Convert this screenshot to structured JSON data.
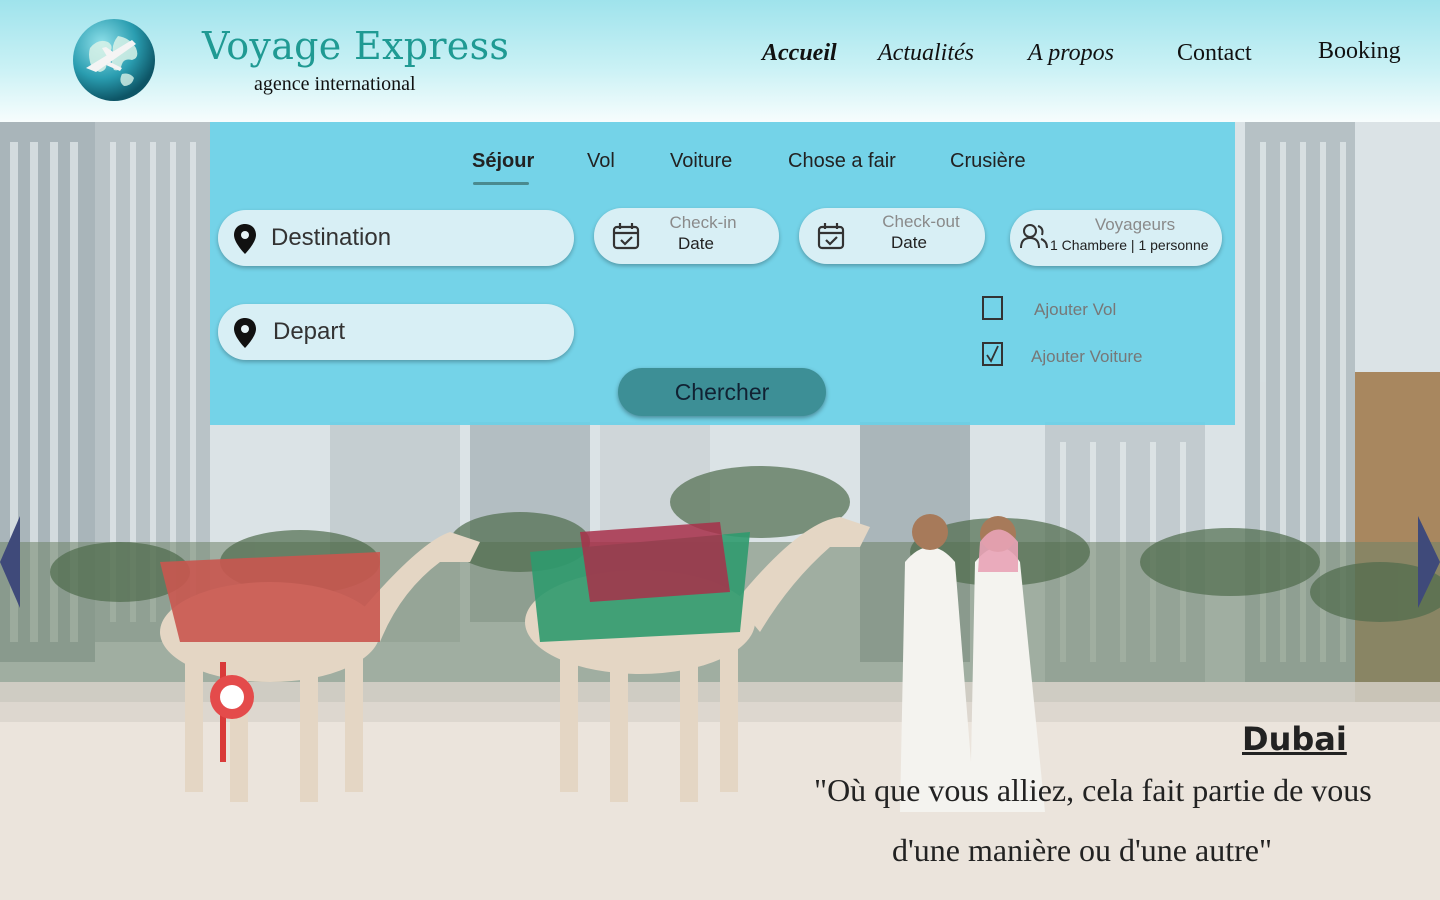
{
  "brand": {
    "title": "Voyage Express",
    "subtitle": "agence international"
  },
  "nav": [
    {
      "label": "Accueil"
    },
    {
      "label": "Actualités"
    },
    {
      "label": "A propos"
    },
    {
      "label": "Contact"
    },
    {
      "label": "Booking"
    }
  ],
  "tabs": [
    {
      "label": "Séjour"
    },
    {
      "label": "Vol"
    },
    {
      "label": "Voiture"
    },
    {
      "label": "Chose a fair"
    },
    {
      "label": "Crusière"
    }
  ],
  "search": {
    "destination_placeholder": "Destination",
    "depart_placeholder": "Depart",
    "checkin_label": "Check-in",
    "checkin_value": "Date",
    "checkout_label": "Check-out",
    "checkout_value": "Date",
    "travelers_label": "Voyageurs",
    "travelers_value": "1 Chambere | 1 personne",
    "add_flight_label": "Ajouter Vol",
    "add_flight_checked": false,
    "add_car_label": "Ajouter Voiture",
    "add_car_checked": true,
    "button_label": "Chercher"
  },
  "hero": {
    "city": "Dubai",
    "quote_line1": "\"Où que vous alliez, cela fait partie de vous",
    "quote_line2": "d'une manière ou d'une autre\""
  },
  "colors": {
    "brand": "#1f9a93",
    "panel": "#68d0e8",
    "button": "#3d8f96",
    "arrow": "#3f4a7a"
  },
  "icons": {
    "logo": "globe-airplane-icon",
    "location": "map-pin-icon",
    "calendar": "calendar-check-icon",
    "travelers": "users-icon",
    "prev": "chevron-left-icon",
    "next": "chevron-right-icon"
  }
}
